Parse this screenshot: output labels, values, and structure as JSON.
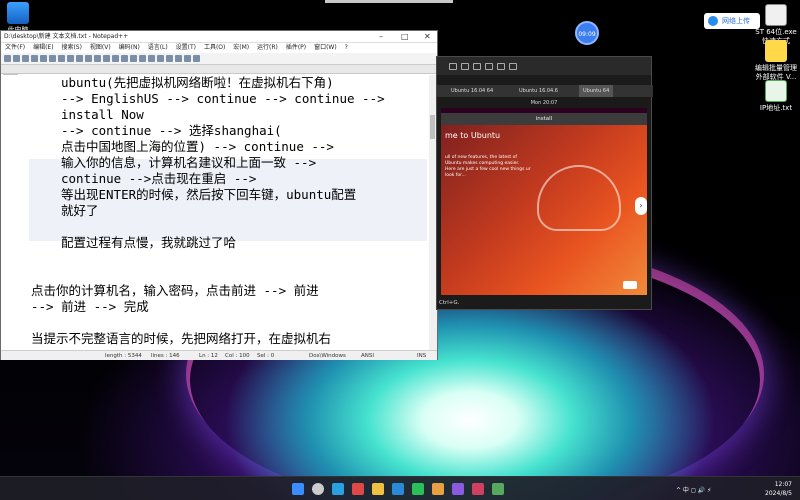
{
  "desktop": {
    "icons": [
      {
        "label": "此电脑"
      },
      {
        "label": "ST 64位.exe 快速方式"
      },
      {
        "label": "编辑批量管理 外部软件 V..."
      },
      {
        "label": "IP地址.txt"
      }
    ],
    "upload_button": "网络上传",
    "time_bubble": "09:09"
  },
  "notepad": {
    "title": "D:\\desktop\\新建 文本文档.txt - Notepad++",
    "menu": [
      "文件(F)",
      "编辑(E)",
      "搜索(S)",
      "视图(V)",
      "编码(N)",
      "语言(L)",
      "设置(T)",
      "工具(O)",
      "宏(M)",
      "运行(R)",
      "插件(P)",
      "窗口(W)",
      "?"
    ],
    "tab": "txt",
    "lines": [
      {
        "text": "ubuntu(先把虚拟机网络断啦！在虚拟机右下角)",
        "style": "indent"
      },
      {
        "text": "--> EnglishUS --> continue --> continue -->",
        "style": "indent"
      },
      {
        "text": "install Now",
        "style": "indent"
      },
      {
        "text": "--> continue --> 选择shanghai(",
        "style": "indent"
      },
      {
        "text": "点击中国地图上海的位置) --> continue -->",
        "style": "indent"
      },
      {
        "text": "输入你的信息，计算机名建议和上面一致 -->",
        "style": "indent"
      },
      {
        "text": "continue -->点击现在重启 -->",
        "style": "indent"
      },
      {
        "text": "等出现ENTER的时候，然后按下回车键，ubuntu配置",
        "style": "indent"
      },
      {
        "text": "就好了",
        "style": "indent"
      },
      {
        "text": "",
        "style": "indent"
      },
      {
        "text": "配置过程有点慢，我就跳过了哈",
        "style": "indent"
      },
      {
        "text": "",
        "style": "indent"
      },
      {
        "text": "",
        "style": "indent"
      },
      {
        "text": "点击你的计算机名，输入密码，点击前进 --> 前进",
        "style": "flush"
      },
      {
        "text": "--> 前进 --> 完成",
        "style": "flush"
      },
      {
        "text": "",
        "style": "flush"
      },
      {
        "text": "当提示不完整语言的时候，先把网络打开，在虚拟机右",
        "style": "flush"
      }
    ],
    "status": {
      "length": "length : 5344",
      "lines": "lines : 146",
      "ln": "Ln : 12",
      "col": "Col : 100",
      "sel": "Sel : 0",
      "eol": "Dos\\Windows",
      "encoding": "ANSI",
      "mode": "INS"
    }
  },
  "vm": {
    "tabs": [
      "Ubuntu 16.04 64",
      "Ubuntu 16.04.6",
      "Ubuntu 64"
    ],
    "topbar": "Mon 20:07",
    "installer_title": "install",
    "welcome": "me to Ubuntu",
    "description": "ull of new features, the latest of Ubuntu makes computing easier. Here are just a few cool new things ur look for...",
    "status": "Ctrl+G."
  },
  "taskbar": {
    "tray": "^  中  ◻  🔊  ⚡",
    "time": "12:07",
    "date": "2024/8/5"
  },
  "colors": {
    "keyword": "#0000a0",
    "ubuntu_orange": "#e95420",
    "selection": "#eef1f8"
  }
}
